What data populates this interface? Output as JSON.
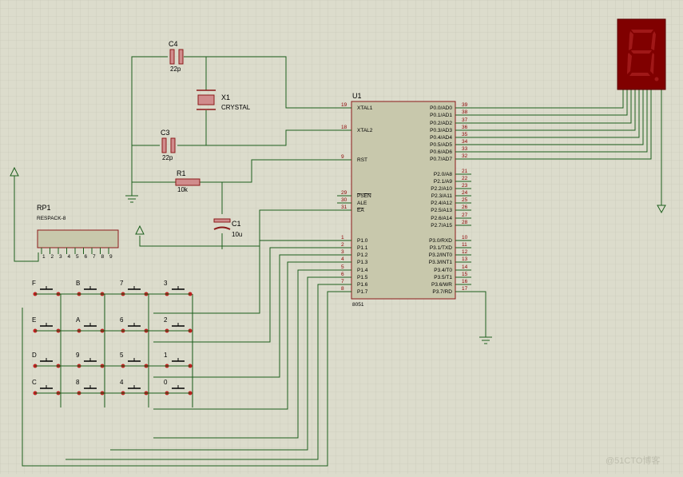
{
  "colors": {
    "background": "#dcdccc",
    "grid": "#c4c4b4",
    "wire": "#1c5e1c",
    "ic_fill": "#c8c8ac",
    "ic_border": "#8b1a1a",
    "component": "#8b1a1a",
    "display_bg": "#800000",
    "display_segment": "#a01818"
  },
  "u1": {
    "ref": "U1",
    "model": "8051",
    "left_pins": [
      {
        "num": "19",
        "name": "XTAL1"
      },
      {
        "num": "18",
        "name": "XTAL2"
      },
      {
        "num": "9",
        "name": "RST"
      },
      {
        "num": "29",
        "name": "PSEN"
      },
      {
        "num": "30",
        "name": "ALE"
      },
      {
        "num": "31",
        "name": "EA"
      },
      {
        "num": "1",
        "name": "P1.0"
      },
      {
        "num": "2",
        "name": "P1.1"
      },
      {
        "num": "3",
        "name": "P1.2"
      },
      {
        "num": "4",
        "name": "P1.3"
      },
      {
        "num": "5",
        "name": "P1.4"
      },
      {
        "num": "6",
        "name": "P1.5"
      },
      {
        "num": "7",
        "name": "P1.6"
      },
      {
        "num": "8",
        "name": "P1.7"
      }
    ],
    "right_pins": [
      {
        "num": "39",
        "name": "P0.0/AD0"
      },
      {
        "num": "38",
        "name": "P0.1/AD1"
      },
      {
        "num": "37",
        "name": "P0.2/AD2"
      },
      {
        "num": "36",
        "name": "P0.3/AD3"
      },
      {
        "num": "35",
        "name": "P0.4/AD4"
      },
      {
        "num": "34",
        "name": "P0.5/AD5"
      },
      {
        "num": "33",
        "name": "P0.6/AD6"
      },
      {
        "num": "32",
        "name": "P0.7/AD7"
      },
      {
        "num": "21",
        "name": "P2.0/A8"
      },
      {
        "num": "22",
        "name": "P2.1/A9"
      },
      {
        "num": "23",
        "name": "P2.2/A10"
      },
      {
        "num": "24",
        "name": "P2.3/A11"
      },
      {
        "num": "25",
        "name": "P2.4/A12"
      },
      {
        "num": "26",
        "name": "P2.5/A13"
      },
      {
        "num": "27",
        "name": "P2.6/A14"
      },
      {
        "num": "28",
        "name": "P2.7/A15"
      },
      {
        "num": "10",
        "name": "P3.0/RXD"
      },
      {
        "num": "11",
        "name": "P3.1/TXD"
      },
      {
        "num": "12",
        "name": "P3.2/INT0"
      },
      {
        "num": "13",
        "name": "P3.3/INT1"
      },
      {
        "num": "14",
        "name": "P3.4/T0"
      },
      {
        "num": "15",
        "name": "P3.5/T1"
      },
      {
        "num": "16",
        "name": "P3.6/WR"
      },
      {
        "num": "17",
        "name": "P3.7/RD"
      }
    ]
  },
  "c4": {
    "ref": "C4",
    "value": "22p"
  },
  "c3": {
    "ref": "C3",
    "value": "22p"
  },
  "x1": {
    "ref": "X1",
    "value": "CRYSTAL"
  },
  "r1": {
    "ref": "R1",
    "value": "10k"
  },
  "c1": {
    "ref": "C1",
    "value": "10u"
  },
  "rp1": {
    "ref": "RP1",
    "value": "RESPACK-8",
    "pins": [
      "1",
      "2",
      "3",
      "4",
      "5",
      "6",
      "7",
      "8",
      "9"
    ]
  },
  "keypad": {
    "rows": [
      [
        "F",
        "B",
        "7",
        "3"
      ],
      [
        "E",
        "A",
        "6",
        "2"
      ],
      [
        "D",
        "9",
        "5",
        "1"
      ],
      [
        "C",
        "8",
        "4",
        "0"
      ]
    ]
  },
  "display": {
    "digit": "8"
  },
  "watermark": "@51CTO博客"
}
